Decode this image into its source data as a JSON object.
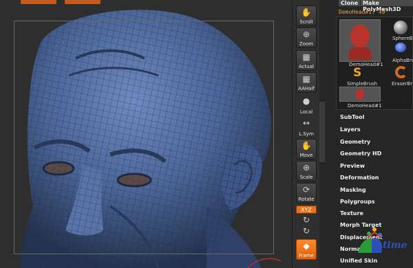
{
  "toolbar": {
    "items": [
      {
        "label": "Scroll",
        "icon": "scroll-icon"
      },
      {
        "label": "Zoom",
        "icon": "zoom-icon"
      },
      {
        "label": "Actual",
        "icon": "actual-icon"
      },
      {
        "label": "AAHalf",
        "icon": "aahalf-icon"
      },
      {
        "label": "Local",
        "icon": "local-icon"
      },
      {
        "label": "L.Sym",
        "icon": "lsym-icon"
      },
      {
        "label": "Move",
        "icon": "move-icon"
      },
      {
        "label": "Scale",
        "icon": "scale-icon"
      },
      {
        "label": "Rotate",
        "icon": "rotate-icon"
      },
      {
        "label": "Frame",
        "icon": "frame-icon"
      }
    ],
    "xyz_label": "XYZ"
  },
  "panel": {
    "buttons": [
      "Clone",
      "Make PolyMesh3D"
    ],
    "current_tool": "DemoHead#1. 49",
    "thumbnails": [
      {
        "label": "DemoHead#1"
      },
      {
        "label": "SphereBr"
      },
      {
        "label": "AlphaBru"
      },
      {
        "label": "SimpleBrush"
      },
      {
        "label": "EraserBr"
      },
      {
        "label": "DemoHead#1"
      }
    ],
    "menu": [
      "SubTool",
      "Layers",
      "Geometry",
      "Geometry HD",
      "Preview",
      "Deformation",
      "Masking",
      "Polygroups",
      "Texture",
      "Morph Target",
      "Displacement",
      "NormalMap",
      "Unified Skin"
    ]
  },
  "watermark": {
    "text": "time"
  },
  "colors": {
    "accent_orange": "#e9711a",
    "mesh_blue": "#4a6496",
    "tool_name": "#e0a24a"
  }
}
